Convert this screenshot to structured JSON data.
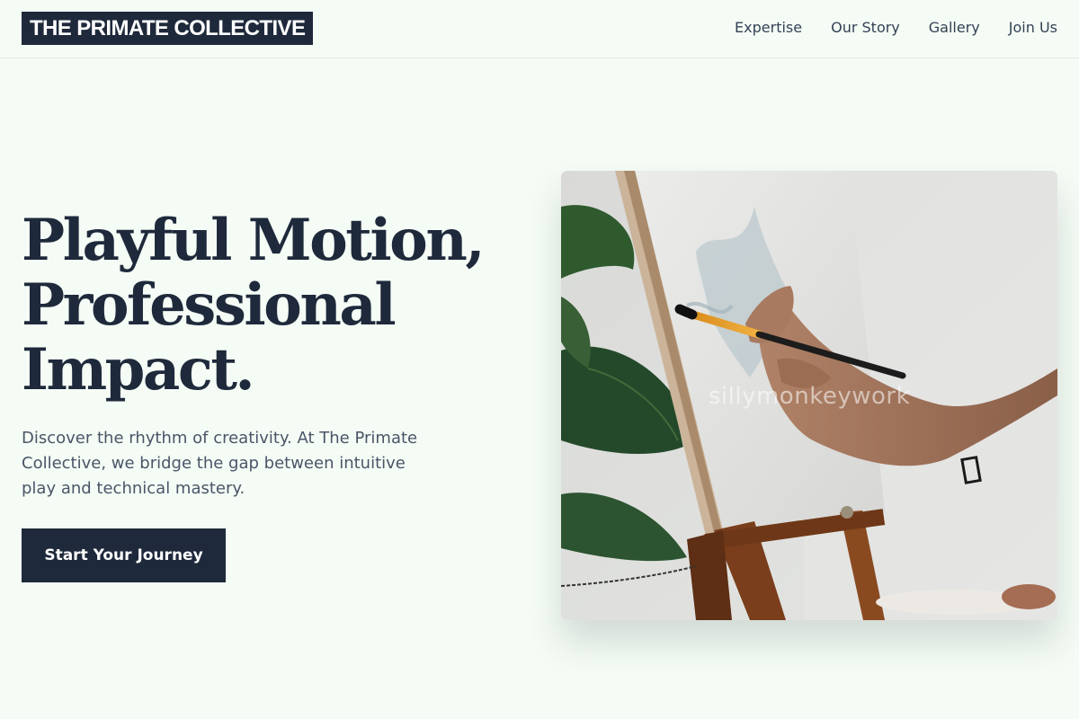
{
  "header": {
    "logo": "THE PRIMATE COLLECTIVE",
    "nav": [
      {
        "label": "Expertise"
      },
      {
        "label": "Our Story"
      },
      {
        "label": "Gallery"
      },
      {
        "label": "Join Us"
      }
    ]
  },
  "hero": {
    "title_lines": [
      "Playful Motion,",
      "Professional",
      "Impact."
    ],
    "description": "Discover the rhythm of creativity. At The Primate Collective, we bridge the gap between intuitive play and technical mastery.",
    "cta_label": "Start Your Journey",
    "image": {
      "subject": "hand-painting-on-easel-canvas",
      "watermark": "sillymonkeywork"
    }
  },
  "colors": {
    "background": "#f5fcf5",
    "primary": "#1e293b",
    "text_muted": "#4a5568"
  }
}
